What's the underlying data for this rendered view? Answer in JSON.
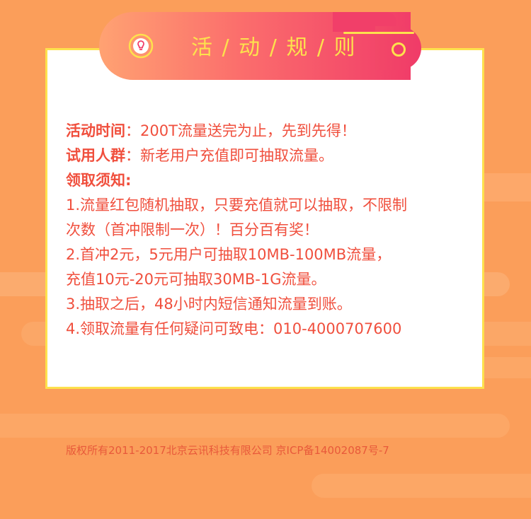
{
  "banner": {
    "title": "活 / 动 / 规 / 则",
    "icon": "lightbulb-icon"
  },
  "rules": {
    "activity_time_label": "活动时间",
    "activity_time_text": "：200T流量送完为止，先到先得！",
    "trial_group_label": "试用人群",
    "trial_group_text": "：新老用户充值即可抽取流量。",
    "notice_label": "领取须知:",
    "items": [
      "1.流量红包随机抽取，只要充值就可以抽取，不限制",
      "次数（首冲限制一次）！百分百有奖！",
      "2.首冲2元，5元用户可抽取10MB-100MB流量，",
      "充值10元-20元可抽取30MB-1G流量。",
      "3.抽取之后，48小时内短信通知流量到账。",
      "4.领取流量有任何疑问可致电：010-4000707600"
    ]
  },
  "footer": {
    "copyright": "版权所有2011-2017北京云讯科技有限公司 京ICP备14002087号-7"
  },
  "colors": {
    "background": "#fb9e5a",
    "accent_yellow": "#fde14d",
    "text_red": "#f04f3d",
    "banner_pink": "#f13d69"
  }
}
